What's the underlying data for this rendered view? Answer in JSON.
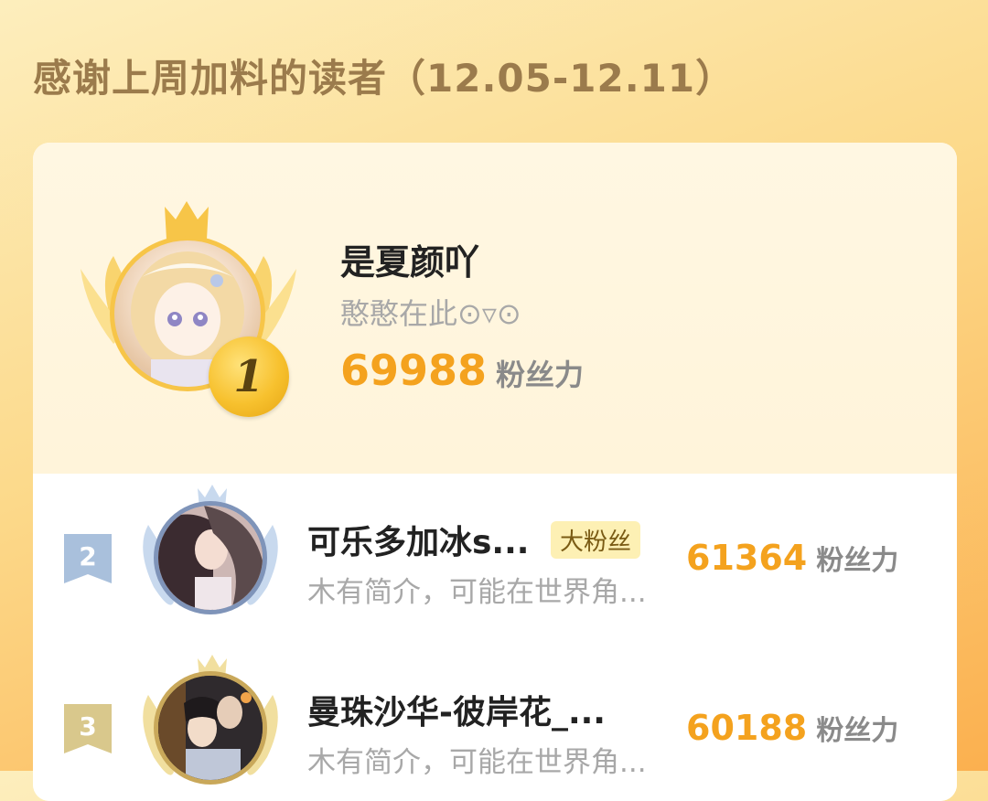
{
  "header": {
    "title": "感谢上周加料的读者（12.05-12.11）"
  },
  "top_reader": {
    "rank": "1",
    "name": "是夏颜吖",
    "bio": "憨憨在此⊙▿⊙",
    "score": "69988",
    "score_unit": "粉丝力",
    "avatar_icon": "anime-girl-avatar"
  },
  "readers": [
    {
      "rank": "2",
      "name": "可乐多加冰s...",
      "badge": "大粉丝",
      "bio": "木有简介，可能在世界角...",
      "score": "61364",
      "score_unit": "粉丝力",
      "avatar_icon": "anime-couple-avatar"
    },
    {
      "rank": "3",
      "name": "曼珠沙华-彼岸花_...",
      "bio": "木有简介，可能在世界角...",
      "score": "60188",
      "score_unit": "粉丝力",
      "avatar_icon": "anime-couple-avatar"
    }
  ],
  "colors": {
    "gold": "#f7c548",
    "silver": "#a9c0dc",
    "bronze": "#d9c88c",
    "score": "#f4a21e"
  }
}
